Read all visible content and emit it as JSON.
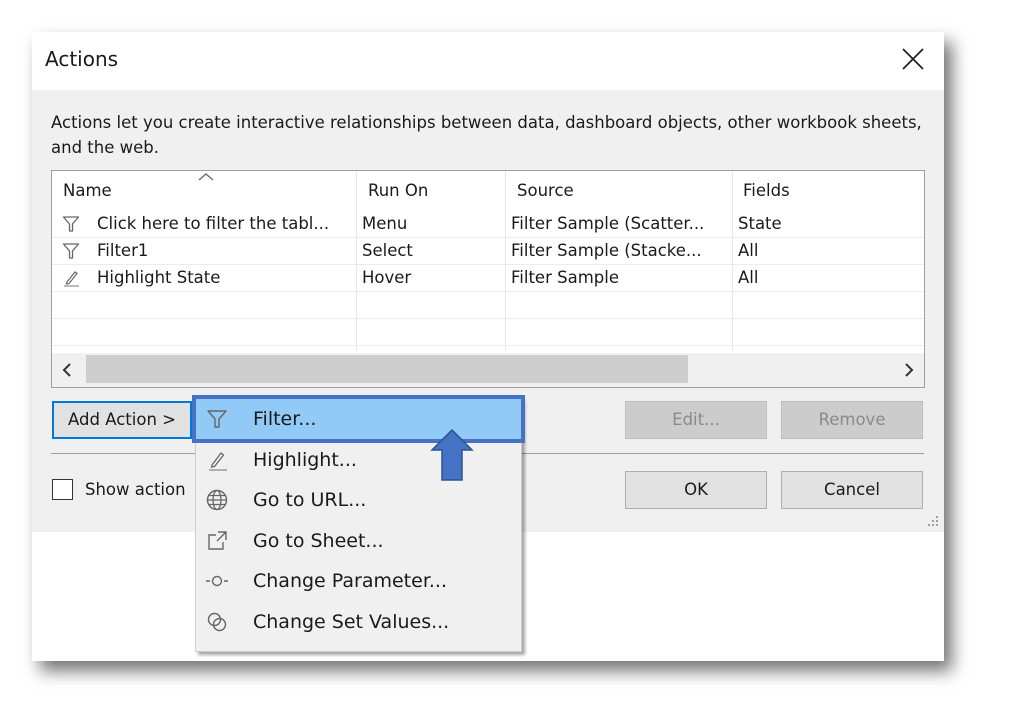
{
  "dialog": {
    "title": "Actions",
    "description": "Actions let you create interactive relationships between data, dashboard objects, other workbook sheets, and the web."
  },
  "table": {
    "columns": [
      "Name",
      "Run On",
      "Source",
      "Fields"
    ],
    "sort_column": "Name",
    "sort_direction": "ascending",
    "rows": [
      {
        "icon": "filter-icon",
        "name": "Click here to filter the tabl...",
        "run_on": "Menu",
        "source": "Filter Sample (Scatter...",
        "fields": "State"
      },
      {
        "icon": "filter-icon",
        "name": "Filter1",
        "run_on": "Select",
        "source": "Filter Sample (Stacke...",
        "fields": "All"
      },
      {
        "icon": "highlight-icon",
        "name": "Highlight State",
        "run_on": "Hover",
        "source": "Filter Sample",
        "fields": "All"
      }
    ]
  },
  "buttons": {
    "add_action": "Add Action >",
    "edit": "Edit...",
    "remove": "Remove",
    "ok": "OK",
    "cancel": "Cancel"
  },
  "checkbox": {
    "label": "Show action",
    "checked": false
  },
  "menu": {
    "items": [
      {
        "icon": "filter-icon",
        "label": "Filter...",
        "selected": true
      },
      {
        "icon": "highlight-icon",
        "label": "Highlight..."
      },
      {
        "icon": "globe-icon",
        "label": "Go to URL..."
      },
      {
        "icon": "go-to-sheet-icon",
        "label": "Go to Sheet..."
      },
      {
        "icon": "parameter-icon",
        "label": "Change Parameter..."
      },
      {
        "icon": "set-values-icon",
        "label": "Change Set Values..."
      }
    ]
  },
  "colors": {
    "menu_highlight": "#91c9f7",
    "callout_blue": "#4472c4",
    "focus_blue": "#0078d7"
  }
}
